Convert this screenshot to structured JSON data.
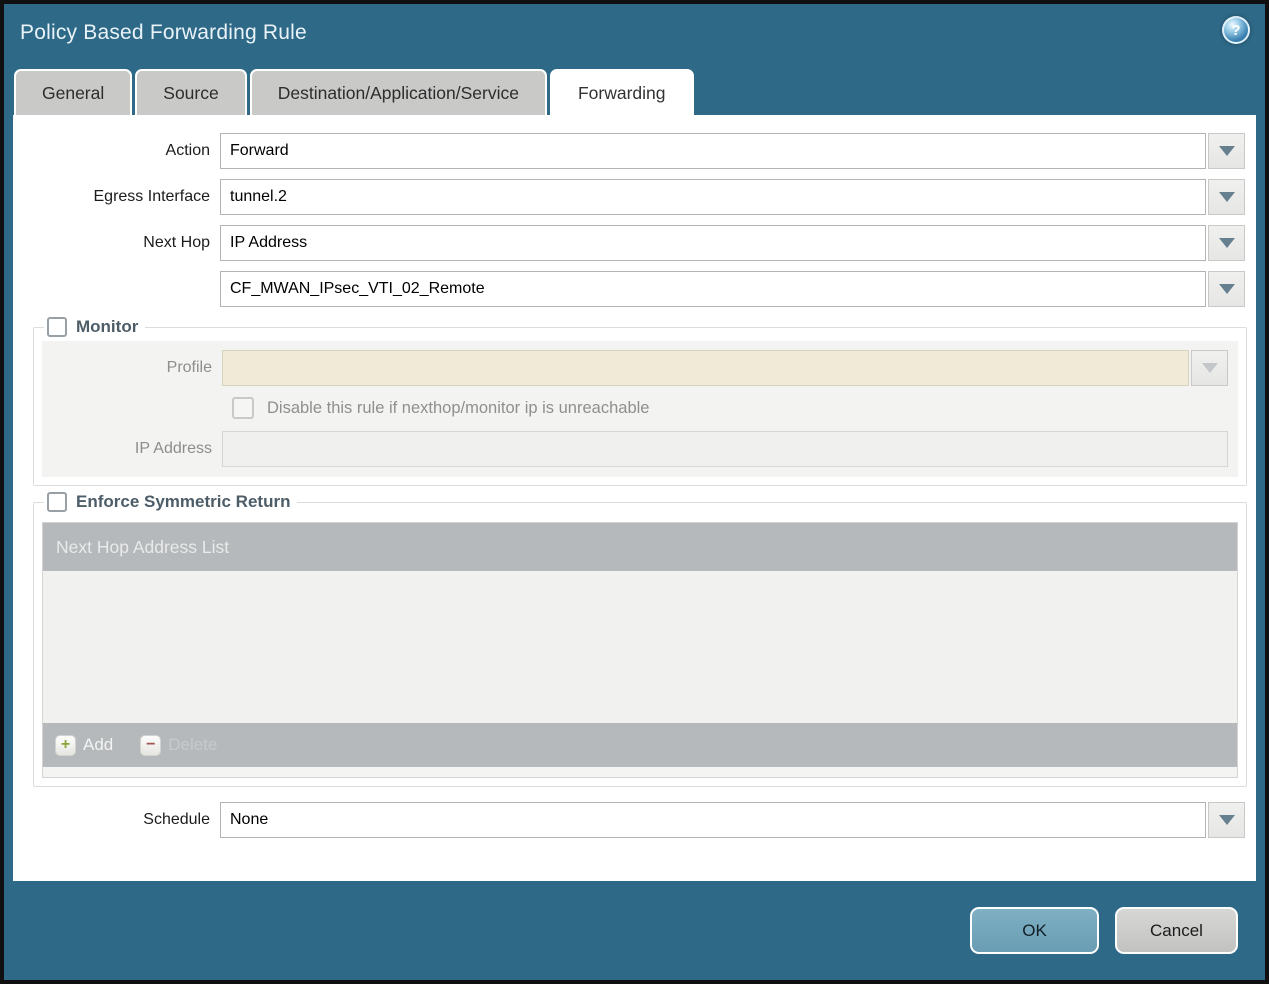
{
  "window": {
    "title": "Policy Based Forwarding Rule"
  },
  "icons": {
    "help": "?",
    "add": "+",
    "delete": "−"
  },
  "tabs": [
    {
      "label": "General",
      "active": false
    },
    {
      "label": "Source",
      "active": false
    },
    {
      "label": "Destination/Application/Service",
      "active": false
    },
    {
      "label": "Forwarding",
      "active": true
    }
  ],
  "form": {
    "action": {
      "label": "Action",
      "value": "Forward"
    },
    "egress_interface": {
      "label": "Egress Interface",
      "value": "tunnel.2"
    },
    "next_hop": {
      "label": "Next Hop",
      "value": "IP Address"
    },
    "next_hop_address": {
      "value": "CF_MWAN_IPsec_VTI_02_Remote"
    },
    "monitor": {
      "legend": "Monitor",
      "checked": false,
      "profile": {
        "label": "Profile",
        "value": ""
      },
      "disable_rule": {
        "label": "Disable this rule if nexthop/monitor ip is unreachable",
        "checked": false
      },
      "ip_address": {
        "label": "IP Address",
        "value": ""
      }
    },
    "enforce_symmetric_return": {
      "legend": "Enforce Symmetric Return",
      "checked": false,
      "table": {
        "header": "Next Hop Address List",
        "rows": []
      },
      "add_label": "Add",
      "delete_label": "Delete"
    },
    "schedule": {
      "label": "Schedule",
      "value": "None"
    }
  },
  "footer": {
    "ok_label": "OK",
    "cancel_label": "Cancel"
  },
  "colors": {
    "titlebar": "#2e6987",
    "accent_ok": "#73a6bb",
    "tab_inactive": "#c9c9c8",
    "table_header": "#b5b9bb",
    "disabled_beige": "#f0ead7",
    "legend_text": "#4d5d68"
  }
}
